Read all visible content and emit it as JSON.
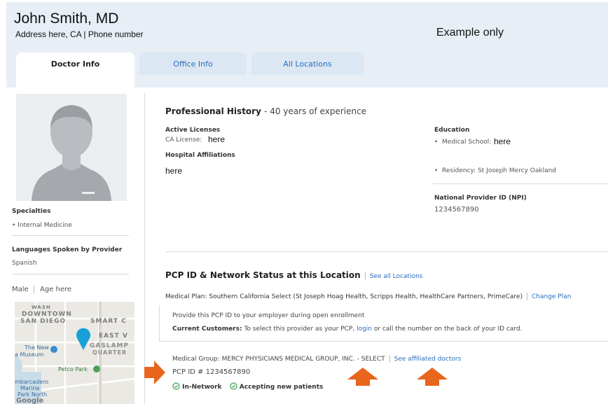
{
  "header": {
    "name": "John Smith, MD",
    "address": "Address here, CA  | Phone number",
    "note": "Example only"
  },
  "tabs": [
    {
      "label": "Doctor Info",
      "active": true
    },
    {
      "label": "Office Info",
      "active": false
    },
    {
      "label": "All Locations",
      "active": false
    }
  ],
  "sidebar": {
    "specialties_label": "Specialties",
    "specialties": [
      "Internal Medicine"
    ],
    "languages_label": "Languages Spoken by Provider",
    "language": "Spanish",
    "gender": "Male",
    "age": "Age here",
    "map_labels": {
      "downtown": "DOWNTOWN",
      "san_diego": "SAN DIEGO",
      "smart": "SMART C",
      "east": "EAST V",
      "gaslamp": "GASLAMP",
      "quarter": "QUARTER",
      "the_new": "The New",
      "museum": "a Museum",
      "petco": "Petco Park",
      "embarcadero": "mbarcadero",
      "marina": "Marina",
      "park_north": "Park North",
      "google": "Google"
    }
  },
  "professional": {
    "title": "Professional History",
    "experience": "- 40 years of experience",
    "licenses_label": "Active Licenses",
    "ca_license_label": "CA License:",
    "ca_license_value": "here",
    "affiliations_label": "Hospital Affiliations",
    "affiliations_value": "here",
    "education_label": "Education",
    "medical_school_label": "Medical School:",
    "medical_school_value": "here",
    "residency": "Residency: St Joseph Mercy Oakland",
    "npi_label": "National Provider ID (NPI)",
    "npi_value": "1234567890"
  },
  "pcp": {
    "title": "PCP ID & Network Status at this Location",
    "see_all": "See all Locations",
    "plan_label": "Medical Plan:",
    "plan_value": "Southern California Select (St Joseph Hoag Health, Scripps Health, HealthCare Partners, PrimeCare)",
    "change_plan": "Change Plan",
    "provide_text": "Provide this PCP ID to your employer during open enrollment",
    "current_label": "Current Customers:",
    "current_text_a": "To select this provider as your PCP,",
    "login": "login",
    "current_text_b": "or call the number on the back of your ID card.",
    "group_label": "Medical Group:",
    "group_value": "MERCY PHYSICIANS MEDICAL GROUP, INC. - SELECT",
    "see_affiliated": "See affiliated doctors",
    "pcp_id": "PCP ID # 1234567890",
    "in_network": "In-Network",
    "accepting": "Accepting new patients"
  },
  "colors": {
    "header_bg": "#e7eef6",
    "tab_inactive": "#dbe7f3",
    "link": "#2a6ebd",
    "arrow": "#e8651c",
    "check": "#3aa34a",
    "map_pin": "#1aa0d8"
  }
}
